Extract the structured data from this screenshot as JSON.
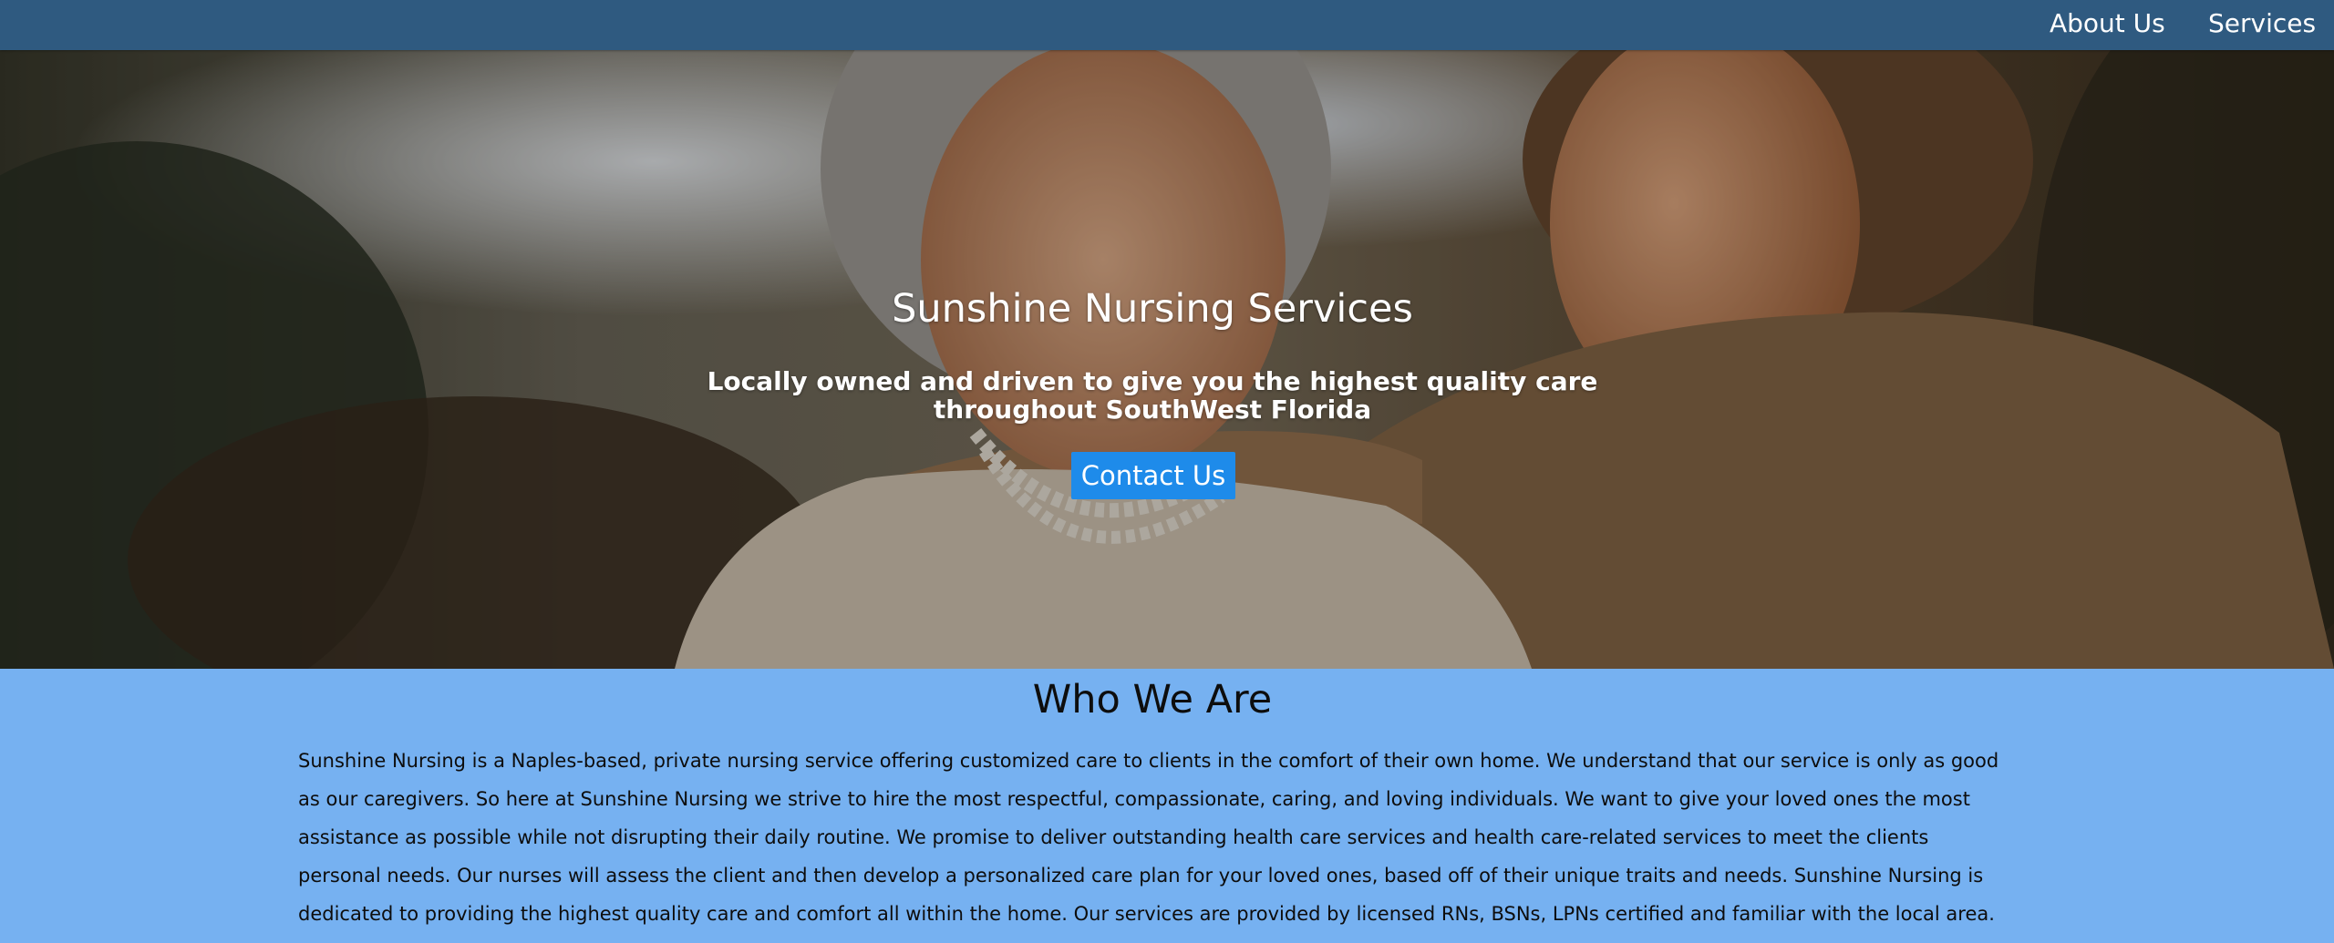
{
  "nav": {
    "items": [
      {
        "label": "About Us"
      },
      {
        "label": "Services"
      }
    ],
    "background_color": "#2f5a80"
  },
  "hero": {
    "title": "Sunshine Nursing Services",
    "subtitle": "Locally owned and driven to give you the highest quality care throughout SouthWest Florida",
    "button_label": "Contact Us",
    "button_color": "#1e8bea"
  },
  "about": {
    "heading": "Who We Are",
    "body": "Sunshine Nursing is a Naples-based, private nursing service offering customized care to clients in the comfort of their own home. We understand that our service is only as good as our caregivers. So here at Sunshine Nursing we strive to hire the most respectful, compassionate, caring, and loving individuals. We want to give your loved ones the most assistance as possible while not disrupting their daily routine. We promise to deliver outstanding health care services and health care-related services to meet the clients personal needs. Our nurses will assess the client and then develop a personalized care plan for your loved ones, based off of their unique traits and needs. Sunshine Nursing is dedicated to providing the highest quality care and comfort all within the home. Our services are provided by licensed RNs, BSNs, LPNs certified and familiar with the local area.",
    "background_color": "#76b1f1"
  }
}
